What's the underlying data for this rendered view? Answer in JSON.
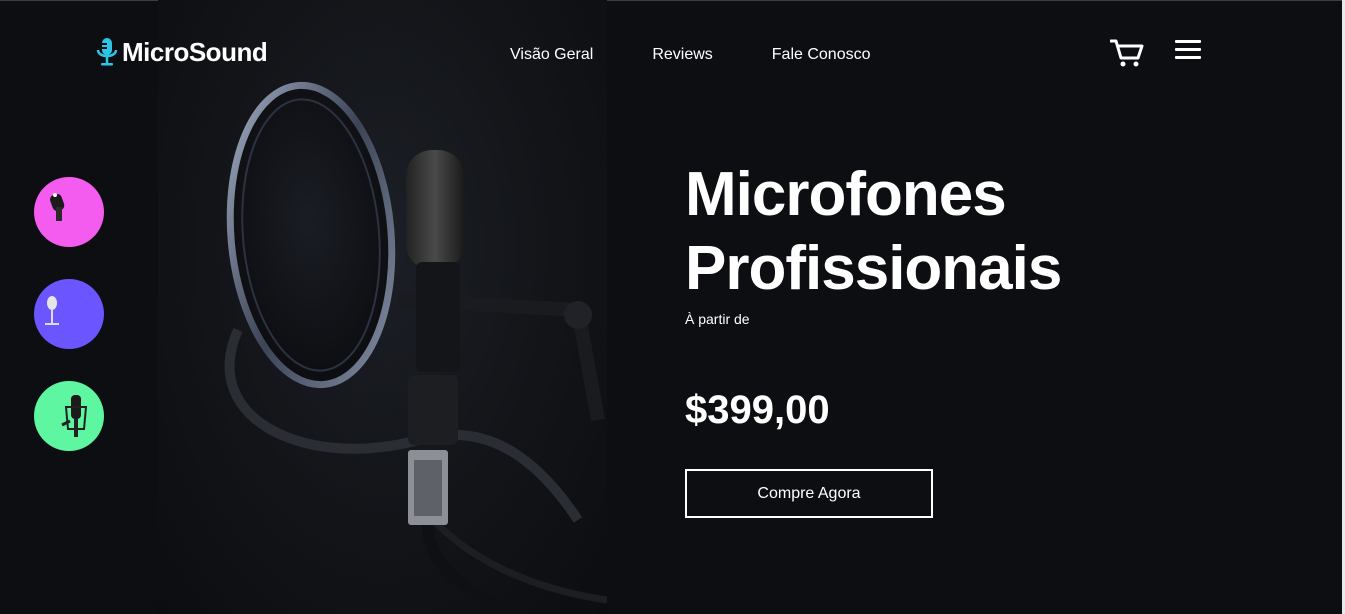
{
  "header": {
    "logo_text": "MicroSound",
    "logo_icon": "microphone-icon",
    "nav": [
      "Visão Geral",
      "Reviews",
      "Fale Conosco"
    ],
    "cart_icon": "cart-icon",
    "menu_icon": "hamburger-menu-icon"
  },
  "thumbnails": [
    {
      "icon": "microphone-thumb-icon",
      "color": "#f45cf0"
    },
    {
      "icon": "vintage-microphone-thumb-icon",
      "color": "#6a55ff"
    },
    {
      "icon": "condenser-microphone-thumb-icon",
      "color": "#5ef6a0"
    }
  ],
  "hero": {
    "title_line1": "Microfones",
    "title_line2": "Profissionais",
    "subtitle": "À partir de",
    "price": "$399,00",
    "cta": "Compre Agora"
  },
  "colors": {
    "background": "#0c0e12",
    "accent": "#2ec4e6"
  }
}
